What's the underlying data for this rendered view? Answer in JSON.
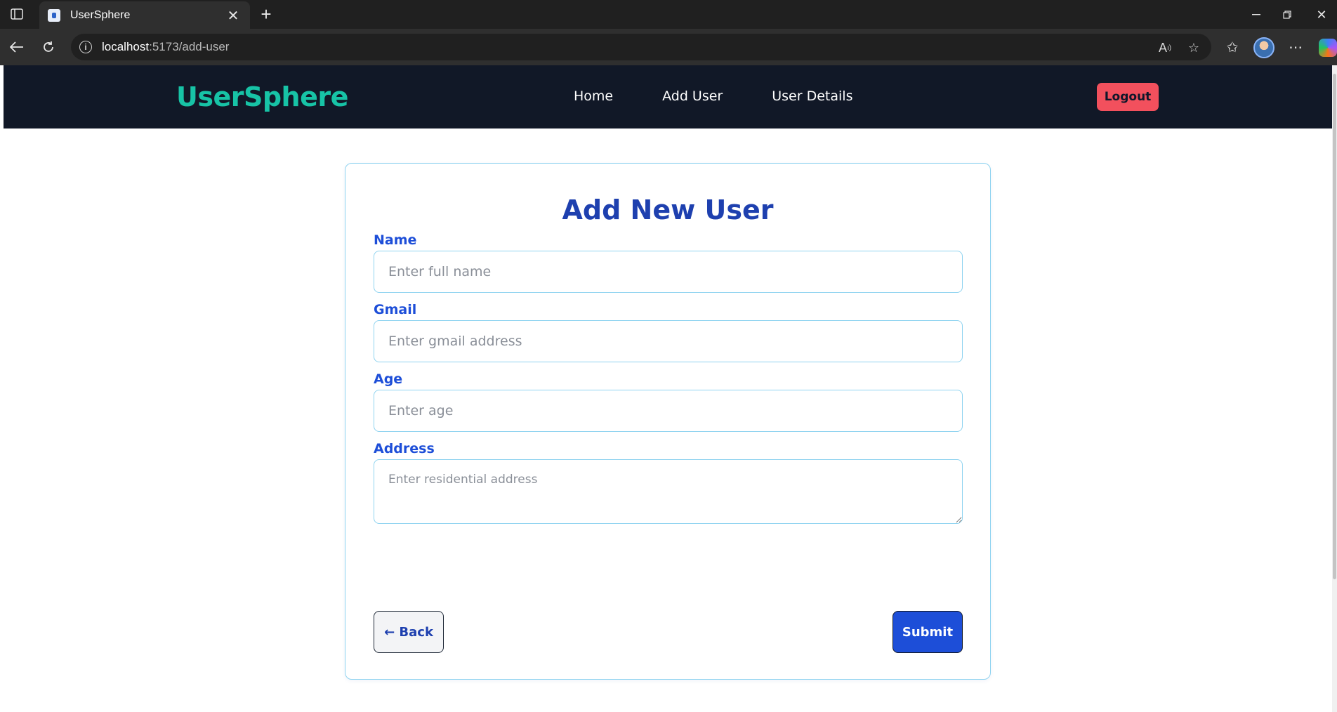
{
  "browser": {
    "tab_title": "UserSphere",
    "url_host": "localhost",
    "url_path": ":5173/add-user"
  },
  "app": {
    "brand": "UserSphere",
    "nav": [
      {
        "label": "Home"
      },
      {
        "label": "Add User"
      },
      {
        "label": "User Details"
      }
    ],
    "logout_label": "Logout"
  },
  "form": {
    "title": "Add New User",
    "name": {
      "label": "Name",
      "placeholder": "Enter full name",
      "value": ""
    },
    "gmail": {
      "label": "Gmail",
      "placeholder": "Enter gmail address",
      "value": ""
    },
    "age": {
      "label": "Age",
      "placeholder": "Enter age",
      "value": ""
    },
    "address": {
      "label": "Address",
      "placeholder": "Enter residential address",
      "value": ""
    },
    "back_label": "← Back",
    "submit_label": "Submit"
  },
  "colors": {
    "navbar_bg": "#111827",
    "brand": "#17c3a6",
    "logout": "#f2505d",
    "title": "#1e40af",
    "label": "#1d4ed8",
    "border": "#8fd3f0",
    "submit": "#1d4ed8"
  }
}
